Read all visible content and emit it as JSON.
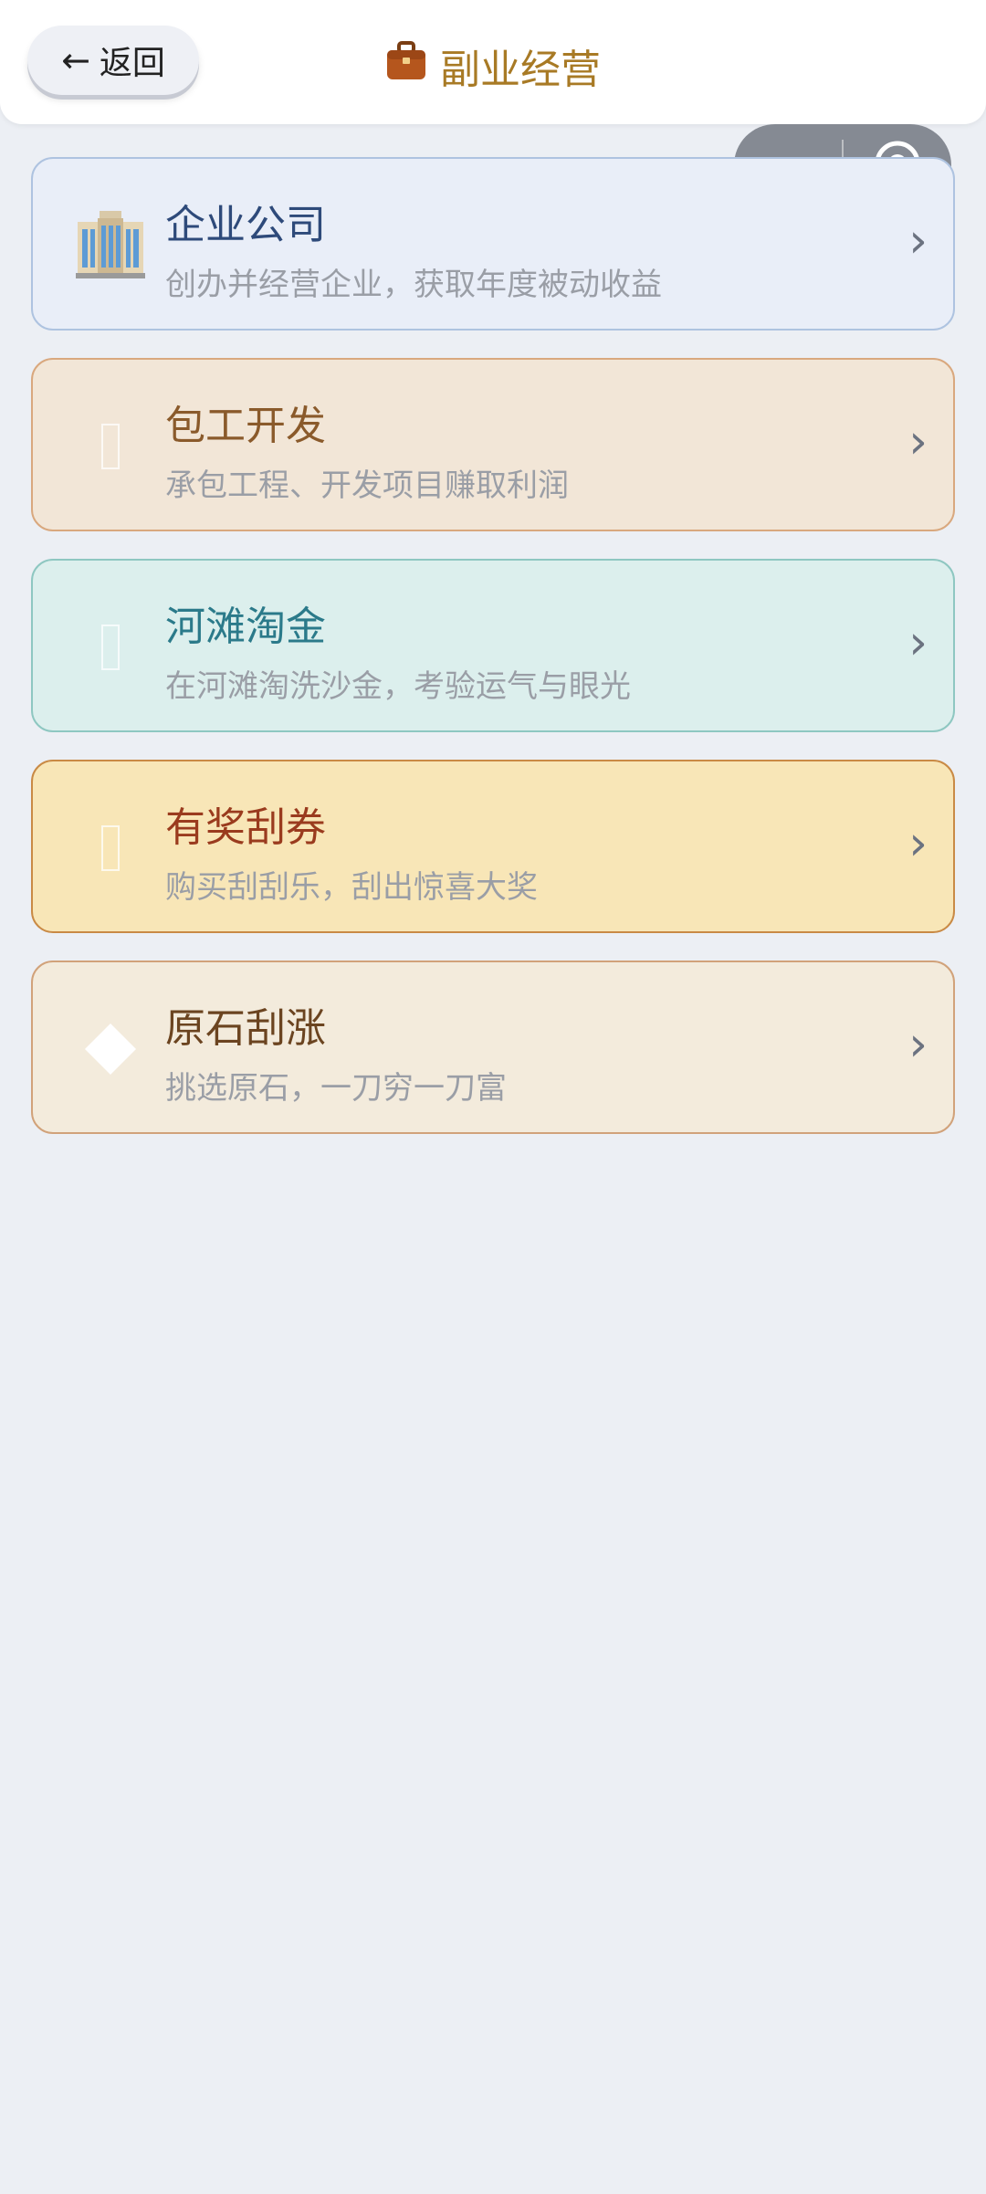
{
  "header": {
    "back_arrow": "←",
    "back_label": "返回",
    "title": "副业经营",
    "title_icon": "briefcase-icon"
  },
  "capsule": {
    "more_icon": "more-dots-icon",
    "close_icon": "target-circle-icon"
  },
  "cards": [
    {
      "name": "企业公司",
      "desc": "创办并经营企业，获取年度被动收益",
      "icon": "office-building-icon",
      "bg": "#e9eef8",
      "border": "#aec3e0",
      "title_color": "#2e4a7a"
    },
    {
      "name": "包工开发",
      "desc": "承包工程、开发项目赚取利润",
      "icon": "construction-icon",
      "bg": "#f2e6d7",
      "border": "#d9a87e",
      "title_color": "#8a5a2b"
    },
    {
      "name": "河滩淘金",
      "desc": "在河滩淘洗沙金，考验运气与眼光",
      "icon": "gold-pan-icon",
      "bg": "#dcefed",
      "border": "#8ec7c1",
      "title_color": "#2b7a8a"
    },
    {
      "name": "有奖刮券",
      "desc": "购买刮刮乐，刮出惊喜大奖",
      "icon": "lottery-ticket-icon",
      "bg": "#f8e6b7",
      "border": "#c98a45",
      "title_color": "#9a3b1e"
    },
    {
      "name": "原石刮涨",
      "desc": "挑选原石，一刀穷一刀富",
      "icon": "gemstone-icon",
      "bg": "#f3ebdc",
      "border": "#d1a27a",
      "title_color": "#6b4420"
    }
  ],
  "chevron": "›"
}
